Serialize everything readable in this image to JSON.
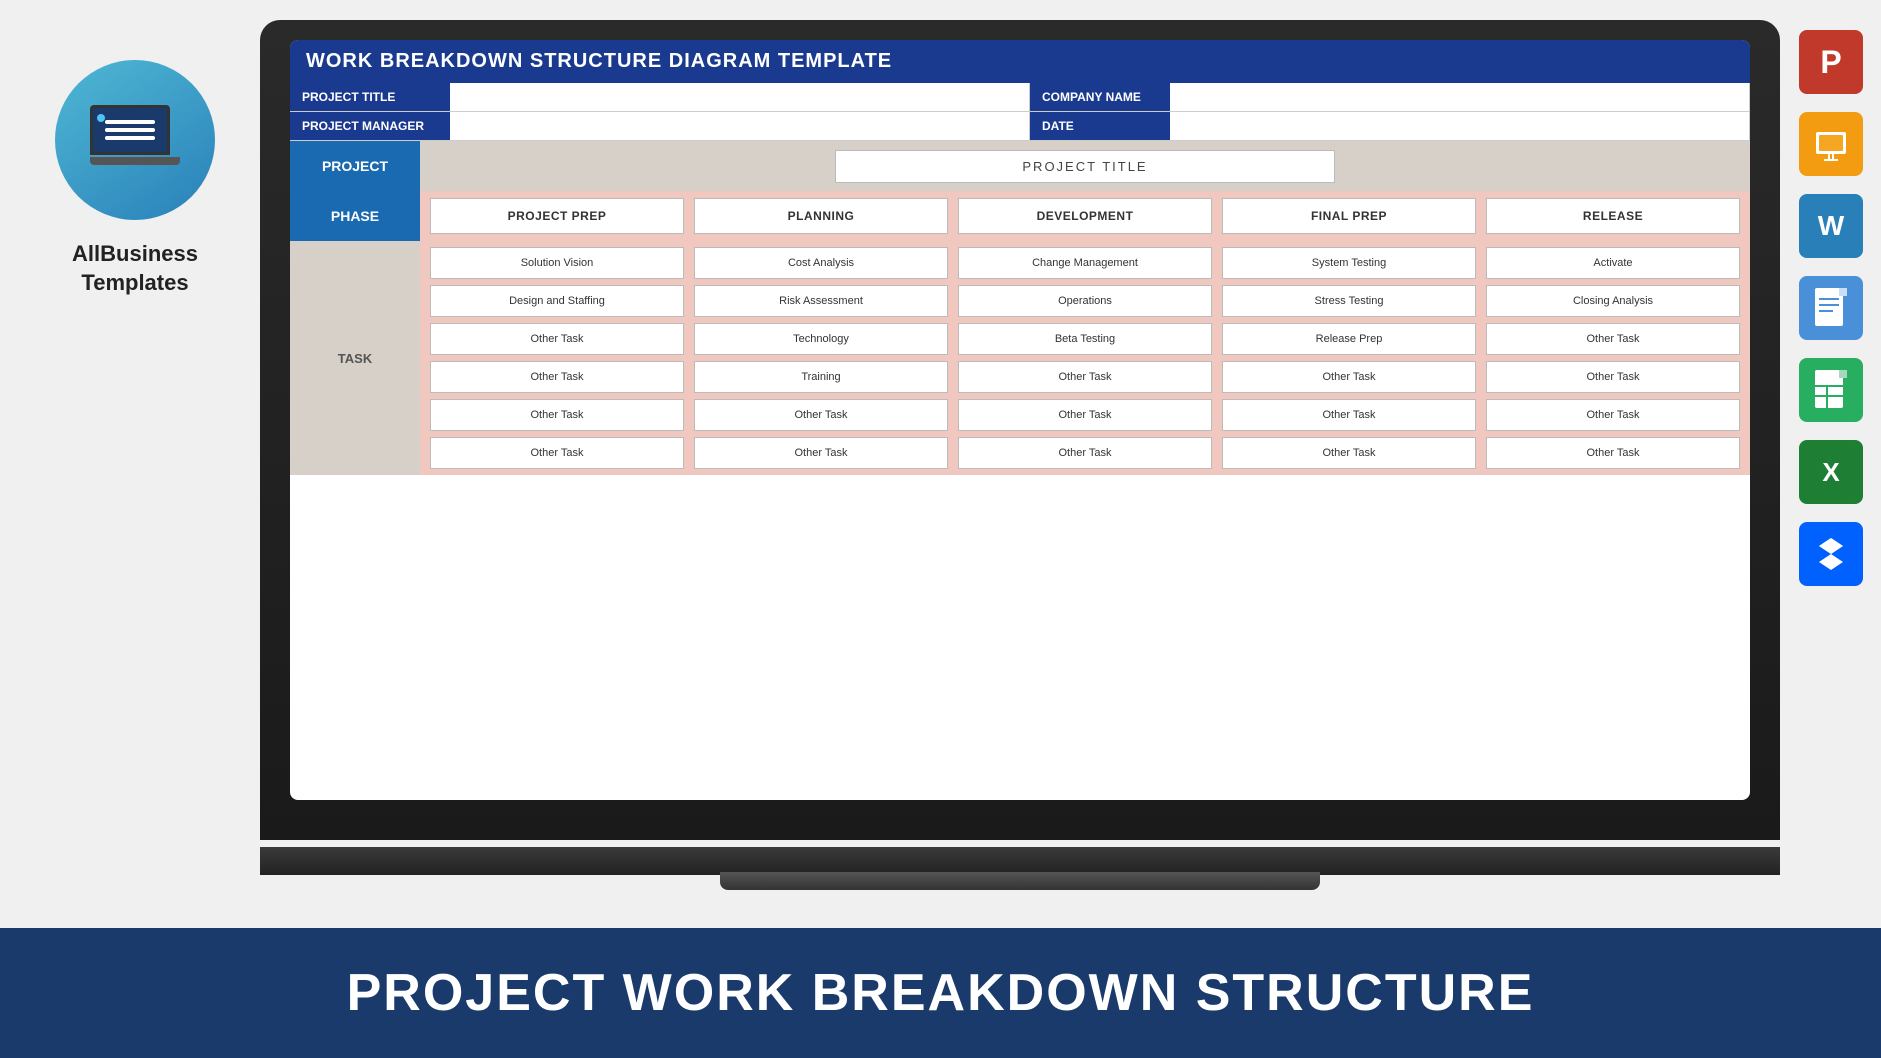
{
  "brand": {
    "name_line1": "AllBusiness",
    "name_line2": "Templates"
  },
  "bottom_banner": {
    "text": "PROJECT WORK BREAKDOWN STRUCTURE"
  },
  "wbs": {
    "title": "WORK BREAKDOWN STRUCTURE DIAGRAM TEMPLATE",
    "fields": {
      "project_title_label": "PROJECT TITLE",
      "project_manager_label": "PROJECT MANAGER",
      "company_name_label": "COMPANY NAME",
      "date_label": "DATE"
    },
    "project_label": "PROJECT",
    "project_title_placeholder": "PROJECT TITLE",
    "phase_label": "PHASE",
    "task_label": "TASK",
    "phases": [
      "PROJECT PREP",
      "PLANNING",
      "DEVELOPMENT",
      "FINAL PREP",
      "RELEASE"
    ],
    "task_rows": [
      [
        "Solution Vision",
        "Cost Analysis",
        "Change Management",
        "System Testing",
        "Activate"
      ],
      [
        "Design and Staffing",
        "Risk Assessment",
        "Operations",
        "Stress Testing",
        "Closing Analysis"
      ],
      [
        "Other Task",
        "Technology",
        "Beta Testing",
        "Release Prep",
        "Other Task"
      ],
      [
        "Other Task",
        "Training",
        "Other Task",
        "Other Task",
        "Other Task"
      ],
      [
        "Other Task",
        "Other Task",
        "Other Task",
        "Other Task",
        "Other Task"
      ],
      [
        "Other Task",
        "Other Task",
        "Other Task",
        "Other Task",
        "Other Task"
      ]
    ]
  },
  "app_icons": {
    "powerpoint": "P",
    "slides": "G",
    "word": "W",
    "docs": "D",
    "sheets": "S",
    "excel": "X",
    "dropbox": "❖"
  }
}
